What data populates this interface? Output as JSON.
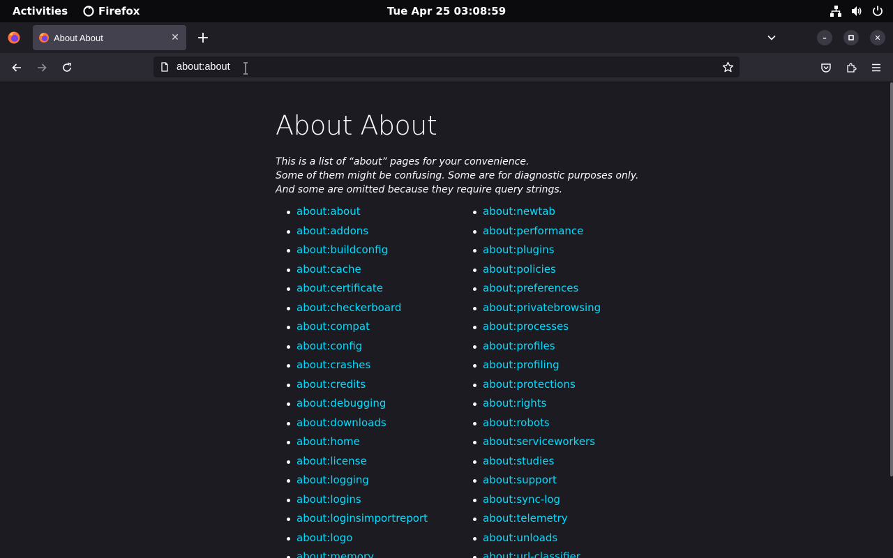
{
  "topbar": {
    "activities": "Activities",
    "app_name": "Firefox",
    "clock": "Tue Apr 25  03:08:59"
  },
  "browser": {
    "tab": {
      "title": "About About"
    },
    "url": "about:about"
  },
  "page": {
    "title": "About About",
    "intro": [
      "This is a list of “about” pages for your convenience.",
      "Some of them might be confusing. Some are for diagnostic purposes only.",
      "And some are omitted because they require query strings."
    ],
    "links_col1": [
      "about:about",
      "about:addons",
      "about:buildconfig",
      "about:cache",
      "about:certificate",
      "about:checkerboard",
      "about:compat",
      "about:config",
      "about:crashes",
      "about:credits",
      "about:debugging",
      "about:downloads",
      "about:home",
      "about:license",
      "about:logging",
      "about:logins",
      "about:loginsimportreport",
      "about:logo",
      "about:memory"
    ],
    "links_col2": [
      "about:newtab",
      "about:performance",
      "about:plugins",
      "about:policies",
      "about:preferences",
      "about:privatebrowsing",
      "about:processes",
      "about:profiles",
      "about:profiling",
      "about:protections",
      "about:rights",
      "about:robots",
      "about:serviceworkers",
      "about:studies",
      "about:support",
      "about:sync-log",
      "about:telemetry",
      "about:unloads",
      "about:url-classifier"
    ]
  },
  "colors": {
    "link": "#00ddff",
    "background": "#1c1b22",
    "text": "#fbfbfe"
  }
}
